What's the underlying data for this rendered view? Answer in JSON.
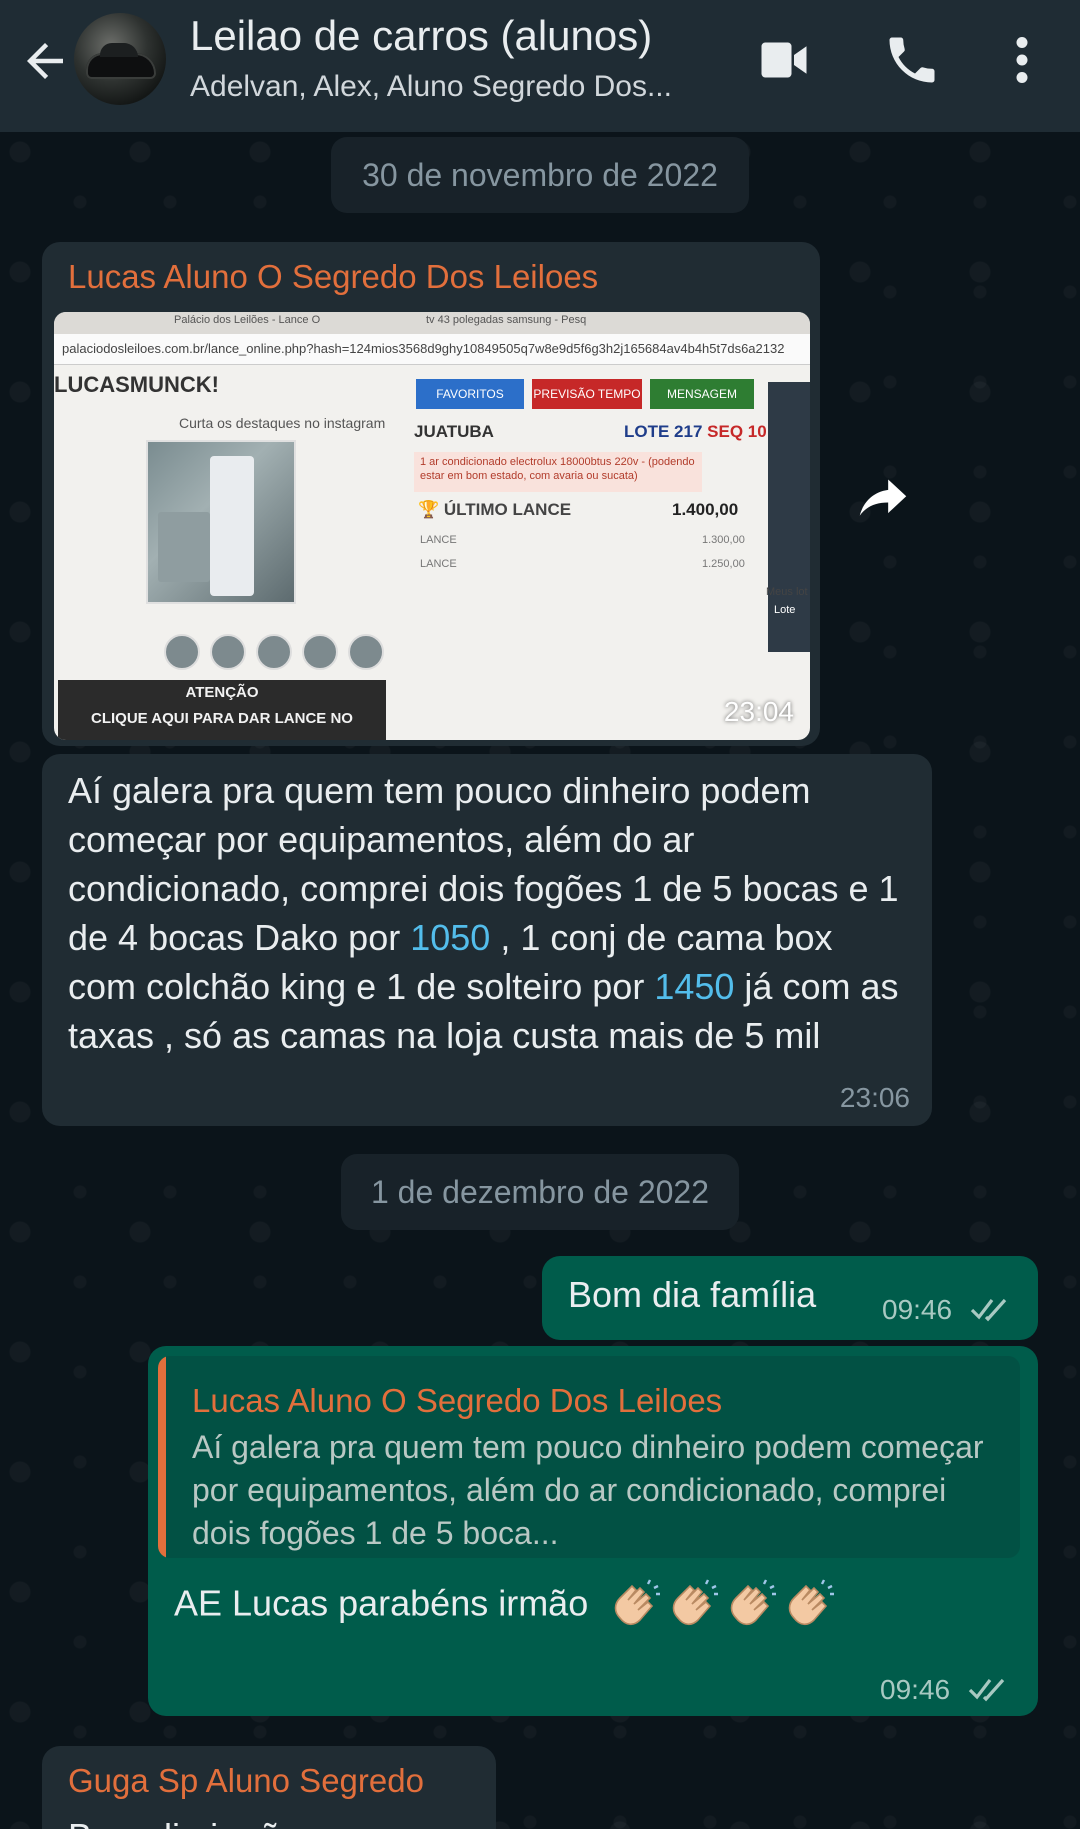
{
  "header": {
    "title": "Leilao de carros (alunos)",
    "subtitle": "Adelvan, Alex, Aluno Segredo Dos..."
  },
  "dates": {
    "first": "30 de novembro de 2022",
    "second": "1 de dezembro de 2022"
  },
  "messages": {
    "m1": {
      "sender": "Lucas Aluno O Segredo Dos Leiloes",
      "time": "23:04",
      "image": {
        "tab1": "Palácio dos Leilões - Lance O",
        "tab2": "tv 43 polegadas samsung - Pesq",
        "url": "palaciodosleiloes.com.br/lance_online.php?hash=124mios3568d9ghy10849505q7w8e9d5f6g3h2j165684av4b4h5t7ds6a2132",
        "logo": "LUCASMUNCK!",
        "instagram": "Curta os destaques no instagram",
        "btn_favoritos": "FAVORITOS",
        "btn_previsao": "PREVISÃO TEMPO",
        "btn_mensagem": "MENSAGEM",
        "location": "JUATUBA",
        "lote": "LOTE 217",
        "seq": "SEQ 10",
        "warning": "1 ar condicionado electrolux 18000btus 220v - (podendo estar em bom estado, com avaria ou sucata)",
        "ultimo_label": "ÚLTIMO LANCE",
        "ultimo_value": "1.400,00",
        "lance_label": "LANCE",
        "lance1": "1.300,00",
        "lance2": "1.250,00",
        "attention_line1": "ATENÇÃO",
        "attention_line2": "CLIQUE AQUI PARA DAR LANCE NO",
        "side_label": "Meus lot",
        "side_label2": "Lote"
      }
    },
    "m2": {
      "text_part1": "Aí galera pra quem tem pouco dinheiro podem começar por equipamentos, além do ar condicionado, comprei dois fogões 1 de 5 bocas e 1 de 4 bocas Dako por ",
      "link1": "1050",
      "text_part2": " , 1 conj de cama box com colchão king e 1 de solteiro por ",
      "link2": "1450",
      "text_part3": " já com as taxas , só as camas na loja custa mais de 5 mil",
      "time": "23:06"
    },
    "m3": {
      "text": "Bom dia família",
      "time": "09:46"
    },
    "m4": {
      "quote_sender": "Lucas Aluno O Segredo Dos Leiloes",
      "quote_text": "Aí galera pra quem tem pouco dinheiro podem começar por equipamentos, além do ar condicionado, comprei dois fogões 1 de 5 boca...",
      "text": "AE Lucas parabéns irmão",
      "time": "09:46"
    },
    "m5": {
      "sender": "Guga Sp Aluno Segredo",
      "text": "Bom dia irmão"
    }
  },
  "colors": {
    "header_bg": "#1f2c34",
    "chat_bg": "#0b141a",
    "incoming_bubble": "#202c33",
    "outgoing_bubble": "#005c4b",
    "sender_name": "#e26f3c",
    "link": "#53bdeb",
    "read_ticks": "#a8c9c2"
  },
  "icons": {
    "back": "arrow-left-icon",
    "video": "video-camera-icon",
    "call": "phone-icon",
    "menu": "more-vertical-icon",
    "forward": "forward-icon",
    "ticks": "double-check-icon",
    "clap": "clapping-hands-emoji"
  }
}
